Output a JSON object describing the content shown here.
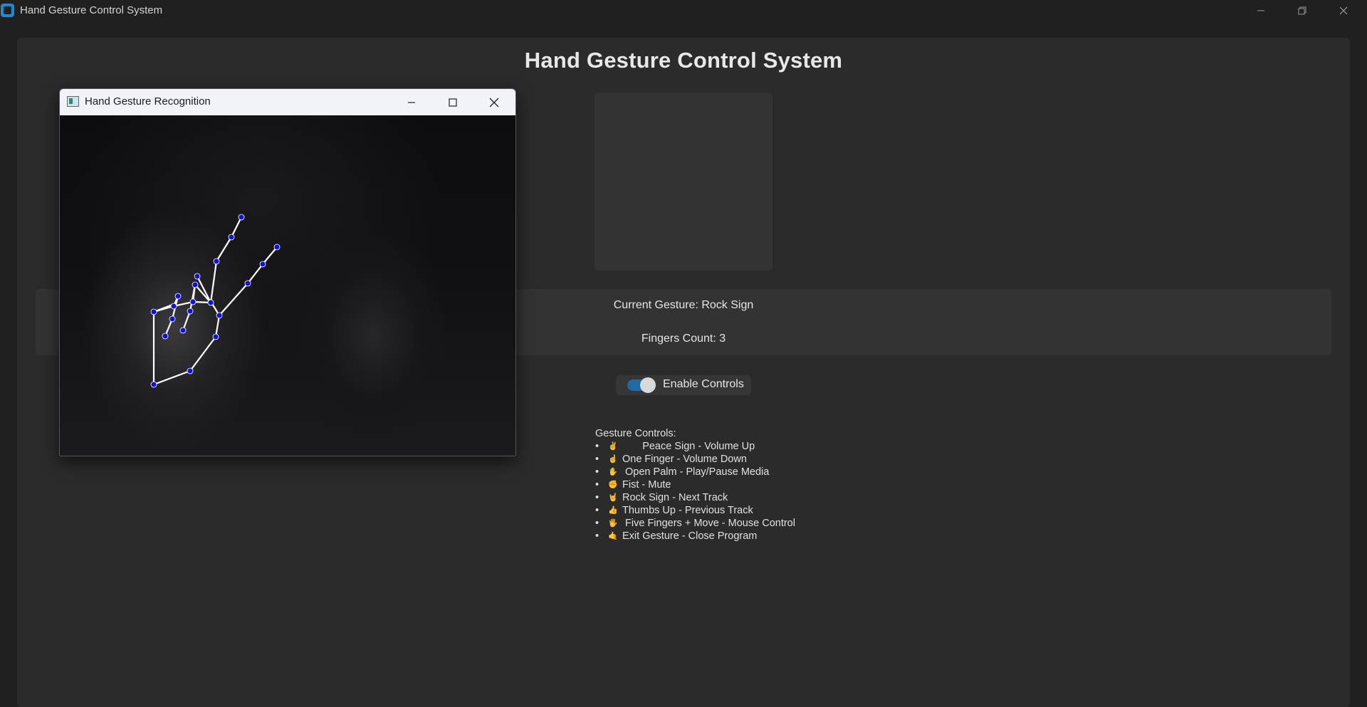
{
  "app": {
    "title": "Hand Gesture Control System",
    "heading": "Hand Gesture Control System"
  },
  "status": {
    "current_gesture": "Current Gesture: Rock Sign",
    "fingers_count": "Fingers Count: 3"
  },
  "toggle": {
    "label": "Enable Controls",
    "enabled": true,
    "accent_color": "#1f6aa5"
  },
  "gesture_controls": {
    "heading": "Gesture Controls:",
    "items": [
      {
        "bullet": "•",
        "icon": "✌",
        "icon_name": "peace-hand-icon",
        "text": "       Peace Sign - Volume Up"
      },
      {
        "bullet": "•",
        "icon": "☝",
        "icon_name": "pointing-finger-icon",
        "text": "One Finger - Volume Down"
      },
      {
        "bullet": "•",
        "icon": "✋",
        "icon_name": "open-palm-icon",
        "text": " Open Palm - Play/Pause Media"
      },
      {
        "bullet": "•",
        "icon": "✊",
        "icon_name": "fist-icon",
        "text": "Fist - Mute"
      },
      {
        "bullet": "•",
        "icon": "🤘",
        "icon_name": "rock-hand-icon",
        "text": "Rock Sign - Next Track"
      },
      {
        "bullet": "•",
        "icon": "👍",
        "icon_name": "thumbs-up-icon",
        "text": "Thumbs Up - Previous Track"
      },
      {
        "bullet": "•",
        "icon": "🖐",
        "icon_name": "five-fingers-icon",
        "text": " Five Fingers + Move - Mouse Control"
      },
      {
        "bullet": "•",
        "icon": "🤙",
        "icon_name": "exit-hand-icon",
        "text": "Exit Gesture - Close Program"
      }
    ]
  },
  "camera_window": {
    "title": "Hand Gesture Recognition"
  },
  "colors": {
    "background": "#202020",
    "frame": "#2b2b2b",
    "panel": "#333333",
    "landmark": "#1010e0",
    "skeleton": "#ffffff"
  }
}
